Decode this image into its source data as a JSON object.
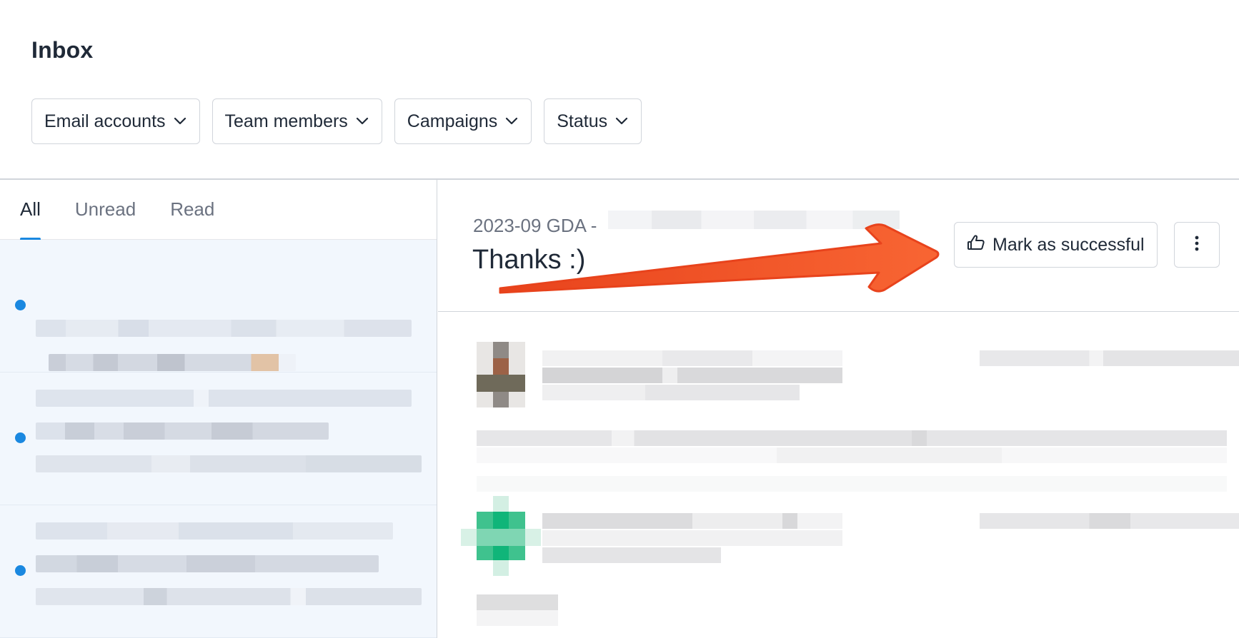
{
  "page": {
    "title": "Inbox"
  },
  "filters": [
    {
      "label": "Email accounts"
    },
    {
      "label": "Team members"
    },
    {
      "label": "Campaigns"
    },
    {
      "label": "Status"
    }
  ],
  "tabs": [
    {
      "label": "All",
      "active": true
    },
    {
      "label": "Unread",
      "active": false
    },
    {
      "label": "Read",
      "active": false
    }
  ],
  "thread": {
    "subject_prefix": "2023-09 GDA -",
    "subject": "Thanks :)",
    "success_button_label": "Mark as successful",
    "more_icon": "kebab-vertical-icon",
    "success_icon": "thumbs-up-icon"
  },
  "colors": {
    "accent": "#1a88e0",
    "unread_dot": "#1a88e0",
    "annotation_arrow": "#f2572a",
    "list_bg": "#f2f7fd"
  }
}
